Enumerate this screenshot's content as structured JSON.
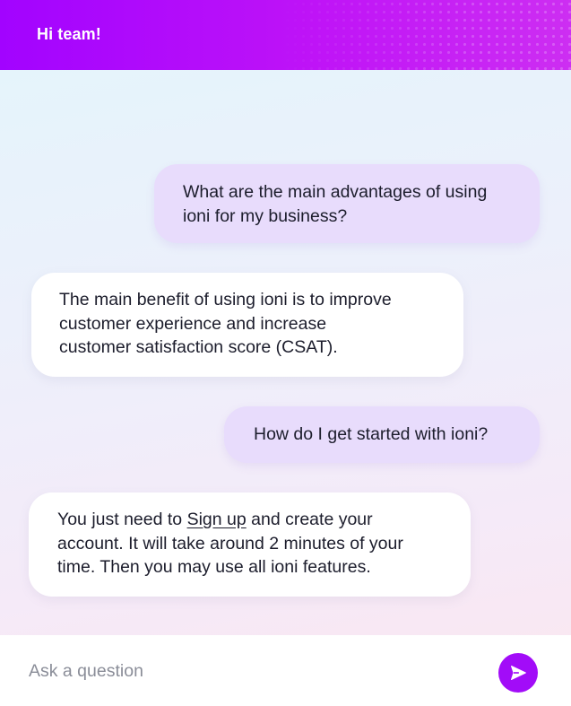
{
  "header": {
    "title": "Hi team!"
  },
  "messages": [
    {
      "role": "user",
      "lines": [
        "What are the main advantages of using",
        "ioni for my business?"
      ]
    },
    {
      "role": "bot",
      "lines": [
        "The main benefit of using ioni is to improve",
        "customer experience and increase",
        "customer satisfaction score (CSAT)."
      ]
    },
    {
      "role": "user",
      "lines": [
        "How do I get started with ioni?"
      ]
    },
    {
      "role": "bot",
      "line1_before": "You just need to ",
      "link_text": "Sign up",
      "line1_after": " and create your",
      "lines_rest": [
        "account. It will take around 2 minutes of your",
        "time. Then you may use all ioni features."
      ]
    }
  ],
  "composer": {
    "placeholder": "Ask a question",
    "value": ""
  },
  "colors": {
    "header_start": "#a203ff",
    "header_end": "#cd2ef2",
    "user_bubble": "#e8dcfc",
    "bot_bubble": "#ffffff",
    "send_button": "#a20cf8"
  },
  "icons": {
    "send": "send-arrow-icon"
  }
}
